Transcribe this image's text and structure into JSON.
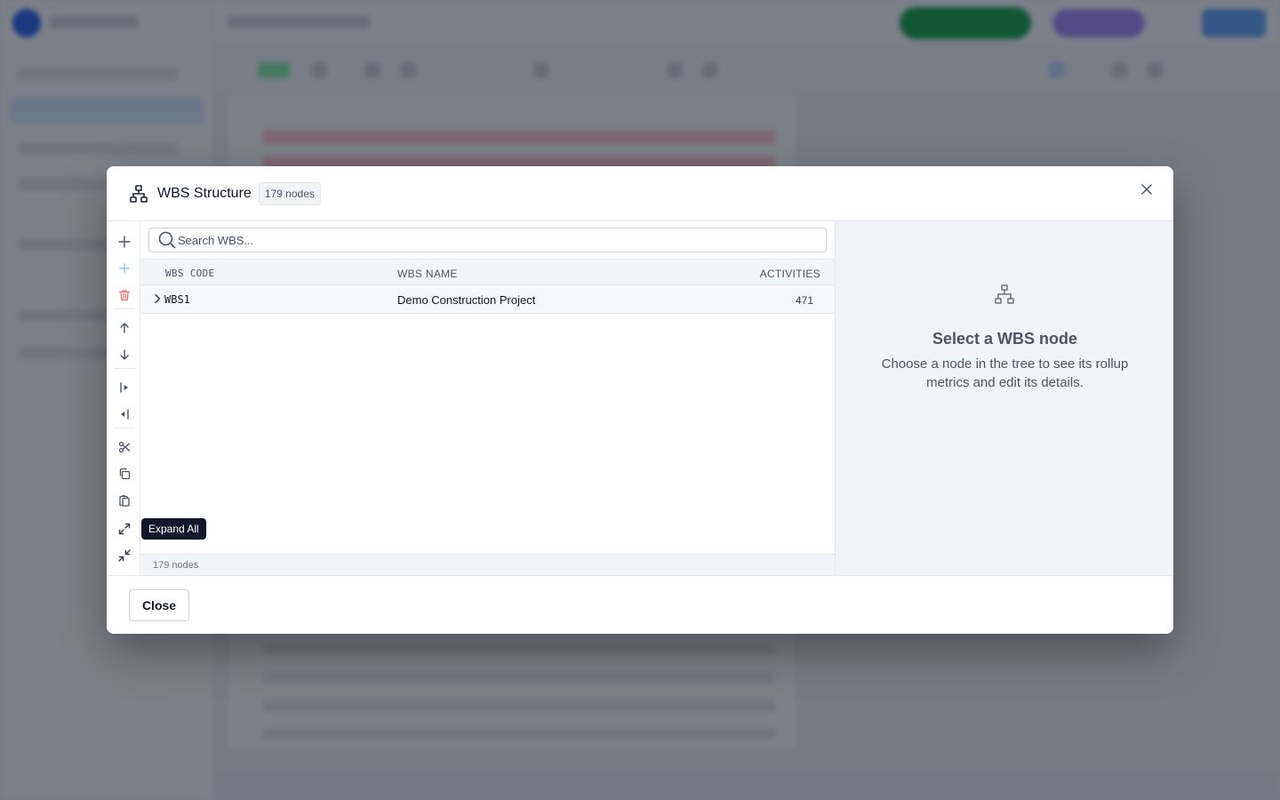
{
  "modal": {
    "title": "WBS Structure",
    "node_badge": "179 nodes",
    "close_label": "Close"
  },
  "search": {
    "placeholder": "Search WBS...",
    "value": ""
  },
  "tree": {
    "columns": [
      "WBS CODE",
      "WBS NAME",
      "ACTIVITIES"
    ],
    "rows": [
      {
        "code": "WBS1",
        "name": "Demo Construction Project",
        "activities": "471",
        "expanded": false
      }
    ],
    "footer": "179 nodes"
  },
  "toolbar": {
    "tools": [
      "plus-icon",
      "add-child-icon",
      "trash-icon",
      "arrow-up-icon",
      "arrow-down-icon",
      "indent-icon",
      "outdent-icon",
      "scissors-icon",
      "copy-icon",
      "paste-icon",
      "expand-all-icon",
      "collapse-all-icon"
    ],
    "tooltip": "Expand All"
  },
  "details": {
    "title": "Select a WBS node",
    "text": "Choose a node in the tree to see its rollup metrics and edit its details."
  },
  "colors": {
    "accent": "#2563eb",
    "delete": "#f87171",
    "overlay": "#111827"
  }
}
